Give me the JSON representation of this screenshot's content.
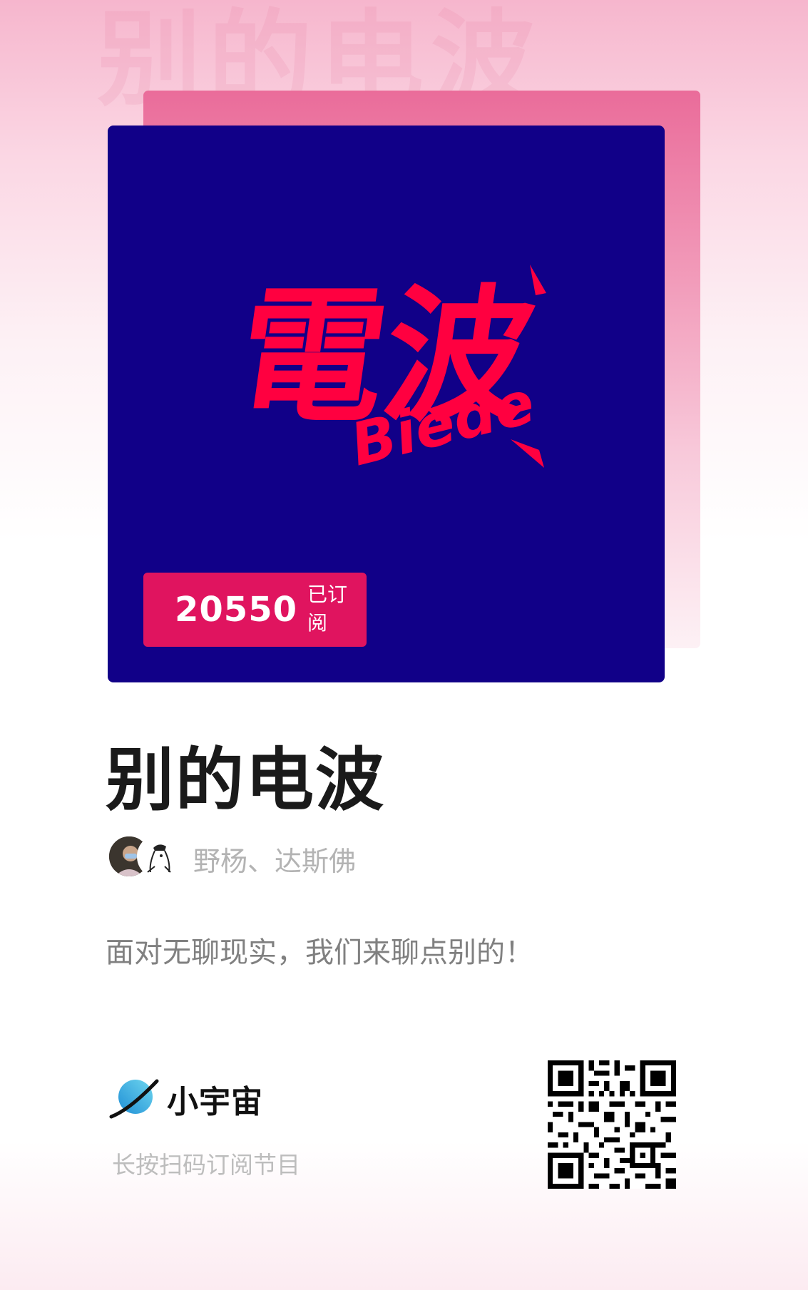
{
  "podcast": {
    "title": "别的电波",
    "cover_logo_text": "電波",
    "cover_logo_subtext": "Biede",
    "subscriber_count": "20550",
    "subscriber_label": "已订阅",
    "hosts": "野杨、达斯佛",
    "tagline": "面对无聊现实，我们来聊点别的！"
  },
  "footer": {
    "brand_name": "小宇宙",
    "scan_hint": "长按扫码订阅节目"
  },
  "colors": {
    "cover_background": "#110088",
    "logo_red": "#ff0040",
    "badge": "#e0145f",
    "accent_pink": "#ea6c9a",
    "brand_blue": "#2fb2e0"
  },
  "icons": {
    "brand": "planet-icon",
    "qr": "qr-code"
  }
}
